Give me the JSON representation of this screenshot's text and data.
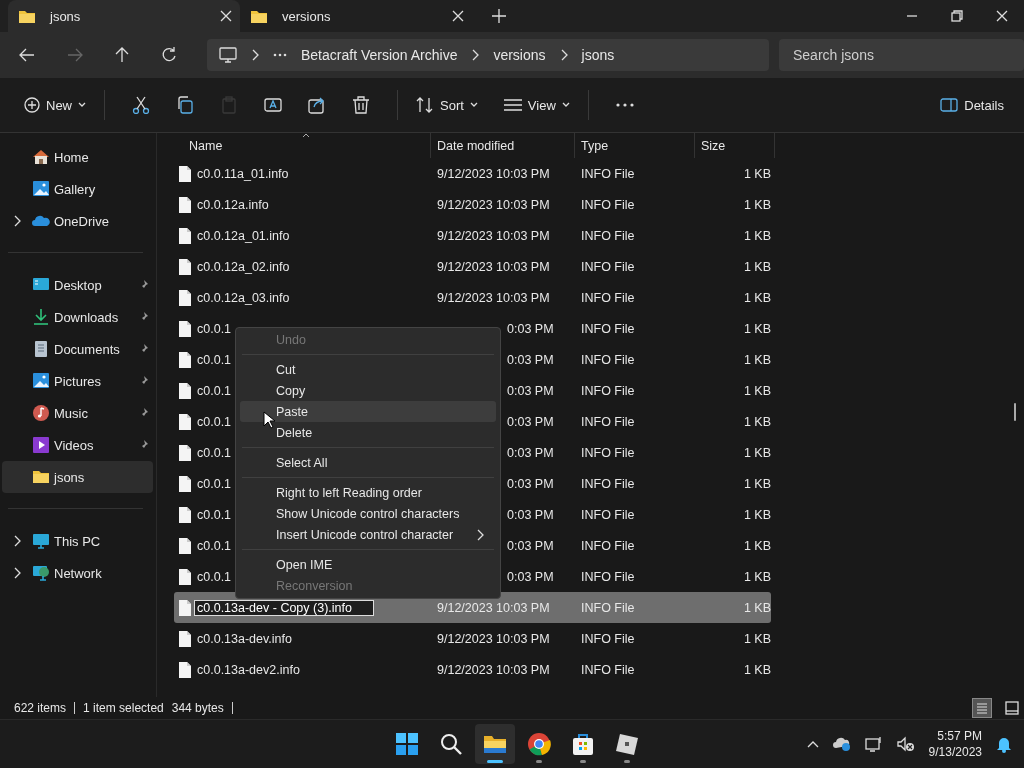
{
  "tabs": [
    {
      "label": "jsons",
      "selected": true
    },
    {
      "label": "versions",
      "selected": false
    }
  ],
  "address": {
    "crumbs": [
      "Betacraft Version Archive",
      "versions",
      "jsons"
    ]
  },
  "search": {
    "placeholder": "Search jsons"
  },
  "toolbar": {
    "new_label": "New",
    "tools": [
      {
        "kind": "cut",
        "disabled": false
      },
      {
        "kind": "copy",
        "disabled": false
      },
      {
        "kind": "paste",
        "disabled": true
      },
      {
        "kind": "rename",
        "disabled": false
      },
      {
        "kind": "share",
        "disabled": false
      },
      {
        "kind": "delete",
        "disabled": false
      }
    ],
    "sort_label": "Sort",
    "view_label": "View",
    "details_label": "Details"
  },
  "sidebar": {
    "sections": [
      [
        {
          "label": "Home",
          "kind": "home",
          "pinned": false,
          "expandable": false,
          "selected": false
        },
        {
          "label": "Gallery",
          "kind": "gallery",
          "pinned": false,
          "expandable": false,
          "selected": false
        },
        {
          "label": "OneDrive",
          "kind": "cloud",
          "pinned": false,
          "expandable": true,
          "selected": false
        }
      ],
      [
        {
          "label": "Desktop",
          "kind": "desktop",
          "pinned": true,
          "expandable": false,
          "selected": false
        },
        {
          "label": "Downloads",
          "kind": "download",
          "pinned": true,
          "expandable": false,
          "selected": false
        },
        {
          "label": "Documents",
          "kind": "document",
          "pinned": true,
          "expandable": false,
          "selected": false
        },
        {
          "label": "Pictures",
          "kind": "gallery",
          "pinned": true,
          "expandable": false,
          "selected": false
        },
        {
          "label": "Music",
          "kind": "music",
          "pinned": true,
          "expandable": false,
          "selected": false
        },
        {
          "label": "Videos",
          "kind": "video",
          "pinned": true,
          "expandable": false,
          "selected": false
        },
        {
          "label": "jsons",
          "kind": "folder",
          "pinned": false,
          "expandable": false,
          "selected": true
        }
      ],
      [
        {
          "label": "This PC",
          "kind": "pc",
          "pinned": false,
          "expandable": true,
          "selected": false
        },
        {
          "label": "Network",
          "kind": "network",
          "pinned": false,
          "expandable": true,
          "selected": false
        }
      ]
    ]
  },
  "table": {
    "columns": [
      "Name",
      "Date modified",
      "Type",
      "Size"
    ],
    "rows": [
      {
        "name": "c0.0.11a_01.info",
        "date": "9/12/2023 10:03 PM",
        "type": "INFO File",
        "size": "1 KB",
        "selected": false,
        "editing": false,
        "covered": false
      },
      {
        "name": "c0.0.12a.info",
        "date": "9/12/2023 10:03 PM",
        "type": "INFO File",
        "size": "1 KB",
        "selected": false,
        "editing": false,
        "covered": false
      },
      {
        "name": "c0.0.12a_01.info",
        "date": "9/12/2023 10:03 PM",
        "type": "INFO File",
        "size": "1 KB",
        "selected": false,
        "editing": false,
        "covered": false
      },
      {
        "name": "c0.0.12a_02.info",
        "date": "9/12/2023 10:03 PM",
        "type": "INFO File",
        "size": "1 KB",
        "selected": false,
        "editing": false,
        "covered": false
      },
      {
        "name": "c0.0.12a_03.info",
        "date": "9/12/2023 10:03 PM",
        "type": "INFO File",
        "size": "1 KB",
        "selected": false,
        "editing": false,
        "covered": false
      },
      {
        "name": "c0.0.1",
        "date": "0:03 PM",
        "type": "INFO File",
        "size": "1 KB",
        "selected": false,
        "editing": false,
        "covered": true
      },
      {
        "name": "c0.0.1",
        "date": "0:03 PM",
        "type": "INFO File",
        "size": "1 KB",
        "selected": false,
        "editing": false,
        "covered": true
      },
      {
        "name": "c0.0.1",
        "date": "0:03 PM",
        "type": "INFO File",
        "size": "1 KB",
        "selected": false,
        "editing": false,
        "covered": true
      },
      {
        "name": "c0.0.1",
        "date": "0:03 PM",
        "type": "INFO File",
        "size": "1 KB",
        "selected": false,
        "editing": false,
        "covered": true
      },
      {
        "name": "c0.0.1",
        "date": "0:03 PM",
        "type": "INFO File",
        "size": "1 KB",
        "selected": false,
        "editing": false,
        "covered": true
      },
      {
        "name": "c0.0.1",
        "date": "0:03 PM",
        "type": "INFO File",
        "size": "1 KB",
        "selected": false,
        "editing": false,
        "covered": true
      },
      {
        "name": "c0.0.1",
        "date": "0:03 PM",
        "type": "INFO File",
        "size": "1 KB",
        "selected": false,
        "editing": false,
        "covered": true
      },
      {
        "name": "c0.0.1",
        "date": "0:03 PM",
        "type": "INFO File",
        "size": "1 KB",
        "selected": false,
        "editing": false,
        "covered": true
      },
      {
        "name": "c0.0.1",
        "date": "0:03 PM",
        "type": "INFO File",
        "size": "1 KB",
        "selected": false,
        "editing": false,
        "covered": true
      },
      {
        "name": "c0.0.13a-dev - Copy (3).info",
        "date": "9/12/2023 10:03 PM",
        "type": "INFO File",
        "size": "1 KB",
        "selected": true,
        "editing": true,
        "covered": false
      },
      {
        "name": "c0.0.13a-dev.info",
        "date": "9/12/2023 10:03 PM",
        "type": "INFO File",
        "size": "1 KB",
        "selected": false,
        "editing": false,
        "covered": false
      },
      {
        "name": "c0.0.13a-dev2.info",
        "date": "9/12/2023 10:03 PM",
        "type": "INFO File",
        "size": "1 KB",
        "selected": false,
        "editing": false,
        "covered": false
      }
    ]
  },
  "context_menu": [
    {
      "kind": "item",
      "label": "Undo",
      "disabled": true,
      "hovered": false,
      "submenu": false
    },
    {
      "kind": "separator"
    },
    {
      "kind": "item",
      "label": "Cut",
      "disabled": false,
      "hovered": false,
      "submenu": false
    },
    {
      "kind": "item",
      "label": "Copy",
      "disabled": false,
      "hovered": false,
      "submenu": false
    },
    {
      "kind": "item",
      "label": "Paste",
      "disabled": false,
      "hovered": true,
      "submenu": false
    },
    {
      "kind": "item",
      "label": "Delete",
      "disabled": false,
      "hovered": false,
      "submenu": false
    },
    {
      "kind": "separator"
    },
    {
      "kind": "item",
      "label": "Select All",
      "disabled": false,
      "hovered": false,
      "submenu": false
    },
    {
      "kind": "separator"
    },
    {
      "kind": "item",
      "label": "Right to left Reading order",
      "disabled": false,
      "hovered": false,
      "submenu": false
    },
    {
      "kind": "item",
      "label": "Show Unicode control characters",
      "disabled": false,
      "hovered": false,
      "submenu": false
    },
    {
      "kind": "item",
      "label": "Insert Unicode control character",
      "disabled": false,
      "hovered": false,
      "submenu": true
    },
    {
      "kind": "separator"
    },
    {
      "kind": "item",
      "label": "Open IME",
      "disabled": false,
      "hovered": false,
      "submenu": false
    },
    {
      "kind": "item",
      "label": "Reconversion",
      "disabled": true,
      "hovered": false,
      "submenu": false
    }
  ],
  "status_bar": {
    "items": [
      "622 items",
      "1 item selected",
      "344 bytes"
    ],
    "view_modes": [
      {
        "kind": "details",
        "selected": true
      },
      {
        "kind": "tiles",
        "selected": false
      }
    ]
  },
  "taskbar": {
    "apps": [
      {
        "kind": "start",
        "active": false,
        "running": false
      },
      {
        "kind": "search",
        "active": false,
        "running": false
      },
      {
        "kind": "explorer",
        "active": true,
        "running": true
      },
      {
        "kind": "browser",
        "active": false,
        "running": true
      },
      {
        "kind": "store",
        "active": false,
        "running": true
      },
      {
        "kind": "cube",
        "active": false,
        "running": true
      }
    ],
    "time": "5:57 PM",
    "date": "9/13/2023"
  }
}
